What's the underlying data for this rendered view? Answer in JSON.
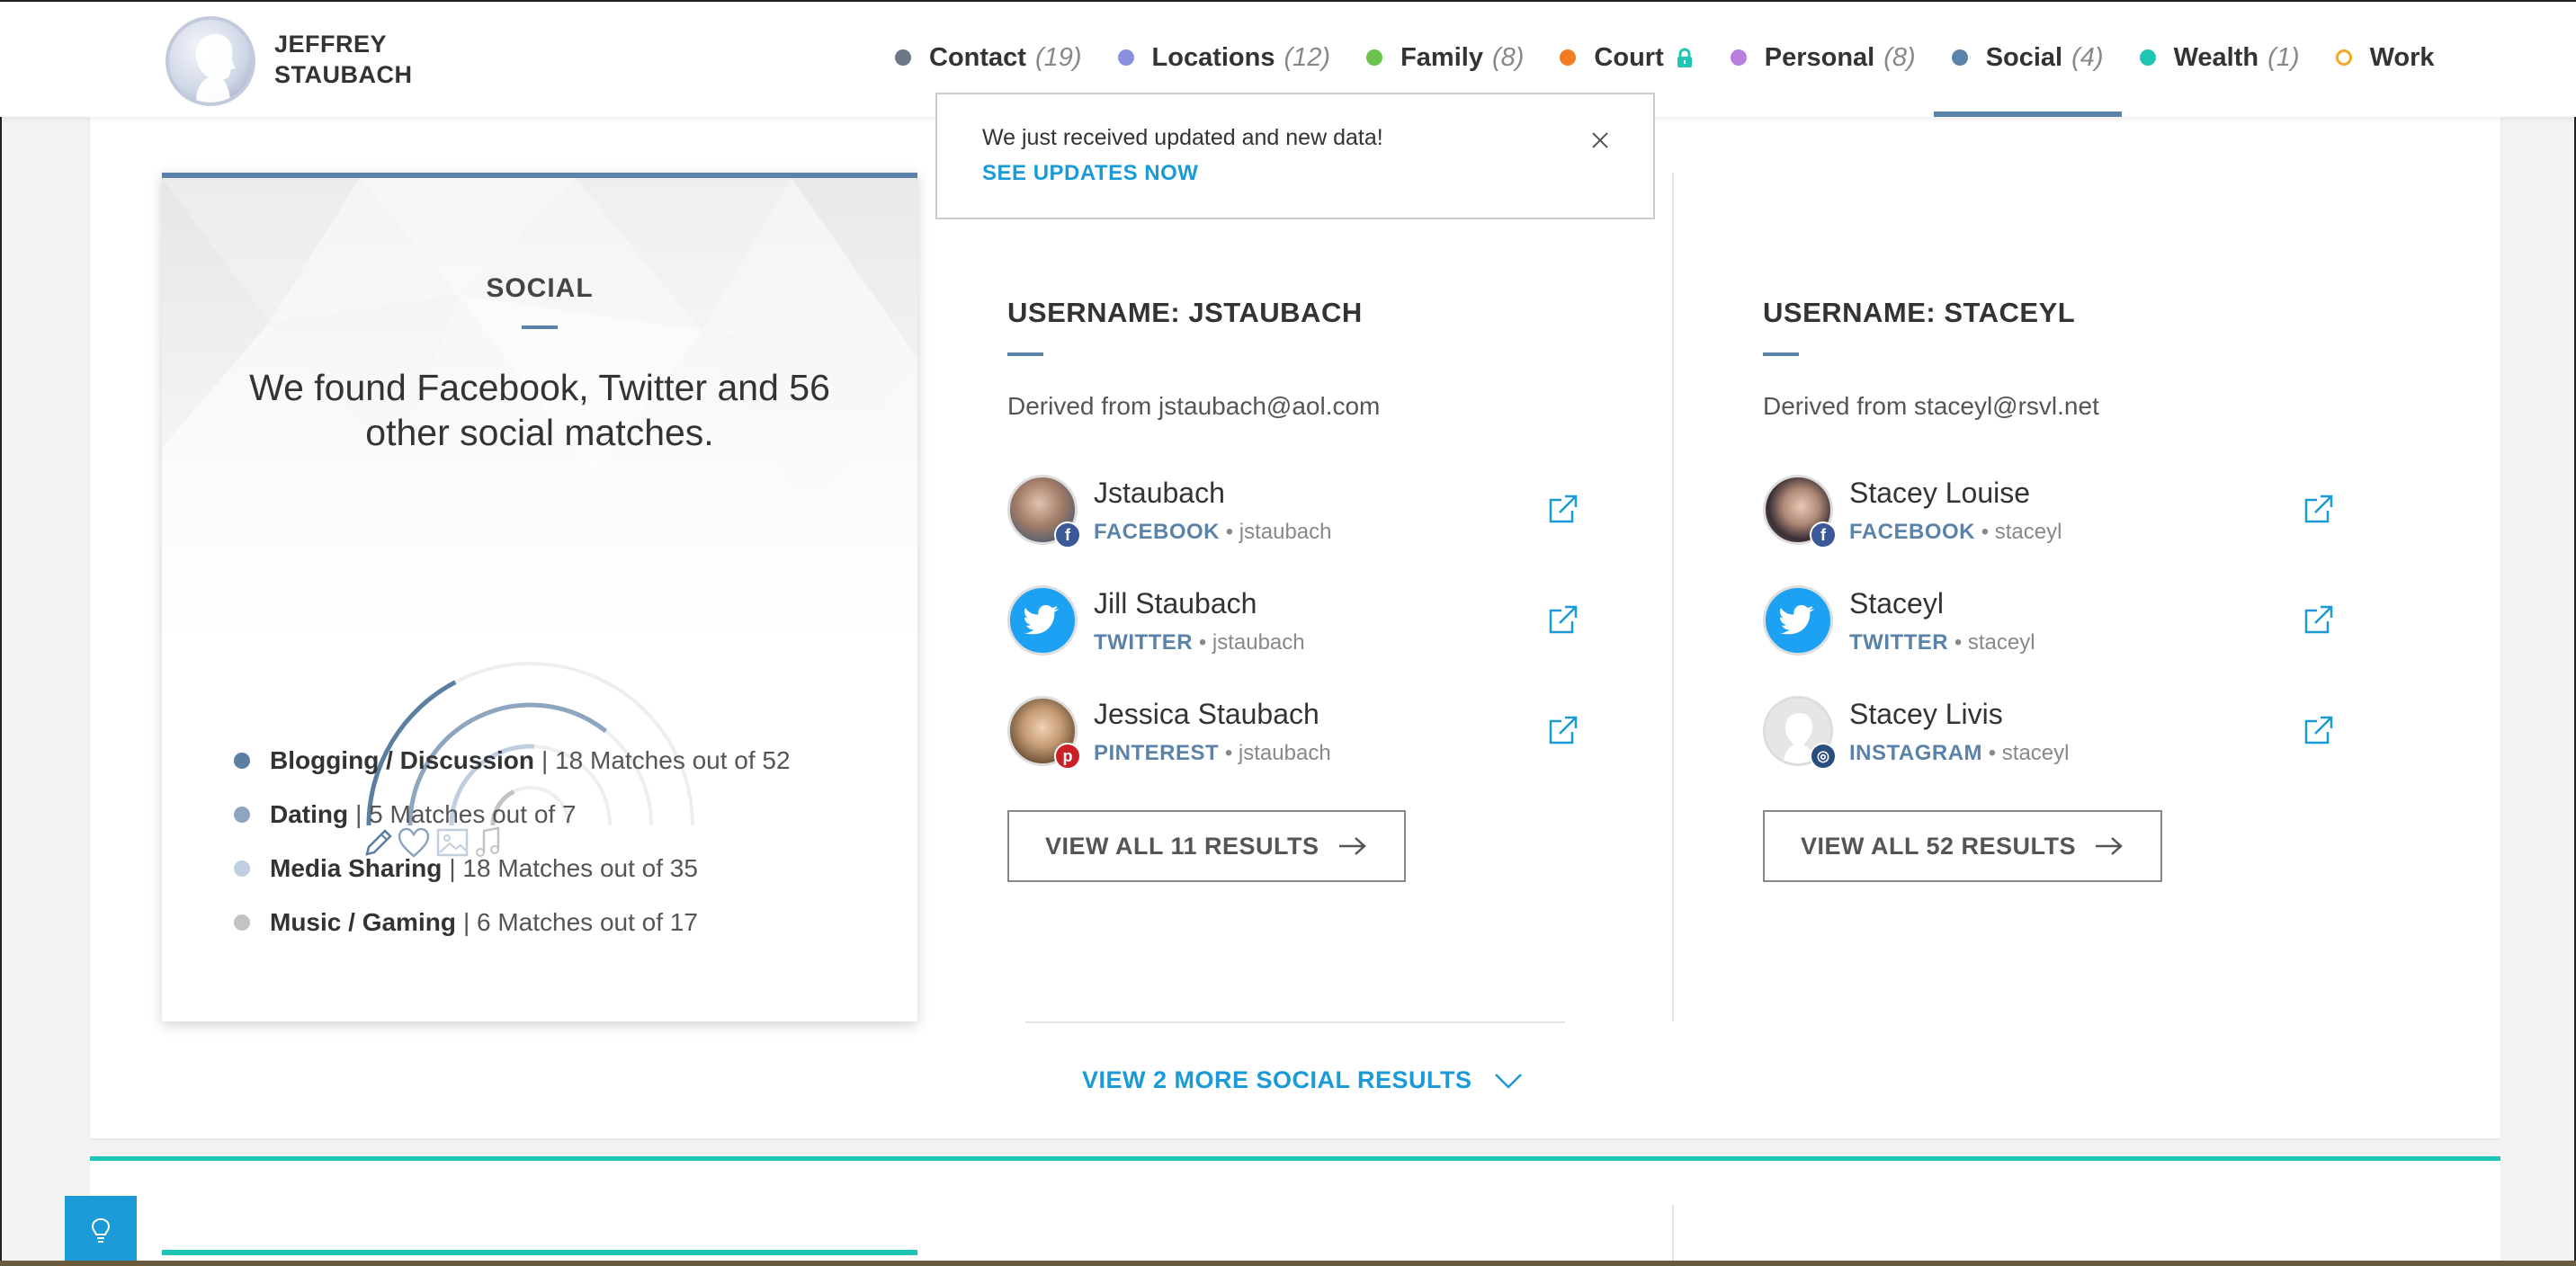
{
  "profile": {
    "name": "JEFFREY\nSTAUBACH",
    "name_line1": "JEFFREY",
    "name_line2": "STAUBACH"
  },
  "nav": [
    {
      "label": "Contact",
      "count": "(19)",
      "color": "#6b7785"
    },
    {
      "label": "Locations",
      "count": "(12)",
      "color": "#8a8fe0"
    },
    {
      "label": "Family",
      "count": "(8)",
      "color": "#6cc24a"
    },
    {
      "label": "Court",
      "count": "",
      "color": "#f47c20",
      "locked": true
    },
    {
      "label": "Personal",
      "count": "(8)",
      "color": "#b77ee0"
    },
    {
      "label": "Social",
      "count": "(4)",
      "color": "#5b82a8",
      "active": true
    },
    {
      "label": "Wealth",
      "count": "(1)",
      "color": "#1ec4b4"
    },
    {
      "label": "Work",
      "count": "",
      "color": "#f5a623",
      "hollow": true
    }
  ],
  "notice": {
    "message": "We just received updated and new data!",
    "link": "SEE UPDATES NOW"
  },
  "summary": {
    "title": "SOCIAL",
    "text": "We found Facebook, Twitter and 56 other social matches.",
    "categories": [
      {
        "name": "Blogging / Discussion",
        "detail": "| 18 Matches out of 52",
        "color": "#5b7ea3",
        "matches": 18,
        "total": 52
      },
      {
        "name": "Dating",
        "detail": "| 5 Matches out of 7",
        "color": "#8ea5bf",
        "matches": 5,
        "total": 7
      },
      {
        "name": "Media Sharing",
        "detail": "| 18 Matches out of 35",
        "color": "#bfcfe0",
        "matches": 18,
        "total": 35
      },
      {
        "name": "Music / Gaming",
        "detail": "| 6 Matches out of 17",
        "color": "#c3c3c3",
        "matches": 6,
        "total": 17
      }
    ]
  },
  "columns": [
    {
      "title": "USERNAME: JSTAUBACH",
      "derived": "Derived from jstaubach@aol.com",
      "results": [
        {
          "name": "Jstaubach",
          "network": "FACEBOOK",
          "handle": "• jstaubach",
          "icon": "facebook-icon",
          "badge_color": "#3b5998",
          "badge": "f"
        },
        {
          "name": "Jill Staubach",
          "network": "TWITTER",
          "handle": "• jstaubach",
          "icon": "twitter-icon",
          "badge_color": "#1da1f2",
          "badge": ""
        },
        {
          "name": "Jessica Staubach",
          "network": "PINTEREST",
          "handle": "• jstaubach",
          "icon": "pinterest-icon",
          "badge_color": "#cb2027",
          "badge": "p"
        }
      ],
      "view_all": "VIEW ALL 11 RESULTS"
    },
    {
      "title": "USERNAME: STACEYL",
      "derived": "Derived from staceyl@rsvl.net",
      "results": [
        {
          "name": "Stacey Louise",
          "network": "FACEBOOK",
          "handle": "• staceyl",
          "icon": "facebook-icon",
          "badge_color": "#3b5998",
          "badge": "f"
        },
        {
          "name": "Staceyl",
          "network": "TWITTER",
          "handle": "• staceyl",
          "icon": "twitter-icon",
          "badge_color": "#1da1f2",
          "badge": ""
        },
        {
          "name": "Stacey Livis",
          "network": "INSTAGRAM",
          "handle": "• staceyl",
          "icon": "instagram-icon",
          "badge_color": "#2a4d80",
          "badge": "◎"
        }
      ],
      "view_all": "VIEW ALL 52 RESULTS"
    }
  ],
  "more": "VIEW 2 MORE SOCIAL RESULTS"
}
